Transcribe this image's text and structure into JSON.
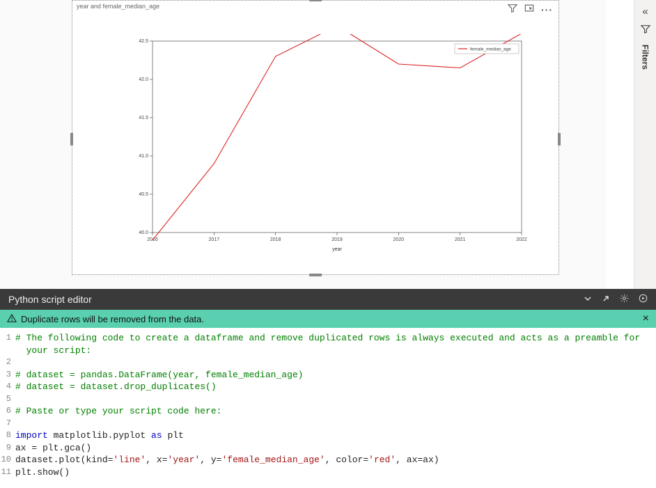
{
  "viz": {
    "title": "year and female_median_age",
    "header_icons": {
      "filter": "filter-icon",
      "focus": "focus-mode-icon",
      "more": "more-options-icon"
    }
  },
  "chart_data": {
    "type": "line",
    "title": "",
    "xlabel": "year",
    "ylabel": "",
    "x": [
      2016,
      2017,
      2018,
      2019,
      2020,
      2021,
      2022
    ],
    "series": [
      {
        "name": "female_median_age",
        "values": [
          39.9,
          40.9,
          42.3,
          42.7,
          42.2,
          42.15,
          42.6
        ],
        "color": "#d22"
      }
    ],
    "ylim": [
      40.0,
      42.5
    ],
    "yticks": [
      40.0,
      40.5,
      41.0,
      41.5,
      42.0,
      42.5
    ],
    "xticks": [
      2016,
      2017,
      2018,
      2019,
      2020,
      2021,
      2022
    ],
    "legend": {
      "position": "upper right",
      "entries": [
        "female_median_age"
      ]
    }
  },
  "side_panel": {
    "label": "Filters"
  },
  "editor": {
    "title": "Python script editor",
    "warning": "Duplicate rows will be removed from the data.",
    "code_lines": [
      {
        "n": 1,
        "tokens": [
          {
            "t": "# The following code to create a dataframe and remove duplicated rows is always executed and acts as a preamble for",
            "c": "comment"
          }
        ]
      },
      {
        "n": "",
        "tokens": [
          {
            "t": "  your script:",
            "c": "comment"
          }
        ]
      },
      {
        "n": 2,
        "tokens": []
      },
      {
        "n": 3,
        "tokens": [
          {
            "t": "# dataset = pandas.DataFrame(year, female_median_age)",
            "c": "comment"
          }
        ]
      },
      {
        "n": 4,
        "tokens": [
          {
            "t": "# dataset = dataset.drop_duplicates()",
            "c": "comment"
          }
        ]
      },
      {
        "n": 5,
        "tokens": []
      },
      {
        "n": 6,
        "tokens": [
          {
            "t": "# Paste or type your script code here:",
            "c": "comment"
          }
        ]
      },
      {
        "n": 7,
        "tokens": []
      },
      {
        "n": 8,
        "tokens": [
          {
            "t": "import",
            "c": "keyword"
          },
          {
            "t": " matplotlib.pyplot ",
            "c": "default"
          },
          {
            "t": "as",
            "c": "keyword"
          },
          {
            "t": " plt",
            "c": "default"
          }
        ]
      },
      {
        "n": 9,
        "tokens": [
          {
            "t": "ax = plt.gca()",
            "c": "default"
          }
        ]
      },
      {
        "n": 10,
        "tokens": [
          {
            "t": "dataset.plot(kind=",
            "c": "default"
          },
          {
            "t": "'line'",
            "c": "string"
          },
          {
            "t": ", x=",
            "c": "default"
          },
          {
            "t": "'year'",
            "c": "string"
          },
          {
            "t": ", y=",
            "c": "default"
          },
          {
            "t": "'female_median_age'",
            "c": "string"
          },
          {
            "t": ", color=",
            "c": "default"
          },
          {
            "t": "'red'",
            "c": "string"
          },
          {
            "t": ", ax=ax)",
            "c": "default"
          }
        ]
      },
      {
        "n": 11,
        "tokens": [
          {
            "t": "plt.show()",
            "c": "default"
          }
        ]
      }
    ]
  }
}
